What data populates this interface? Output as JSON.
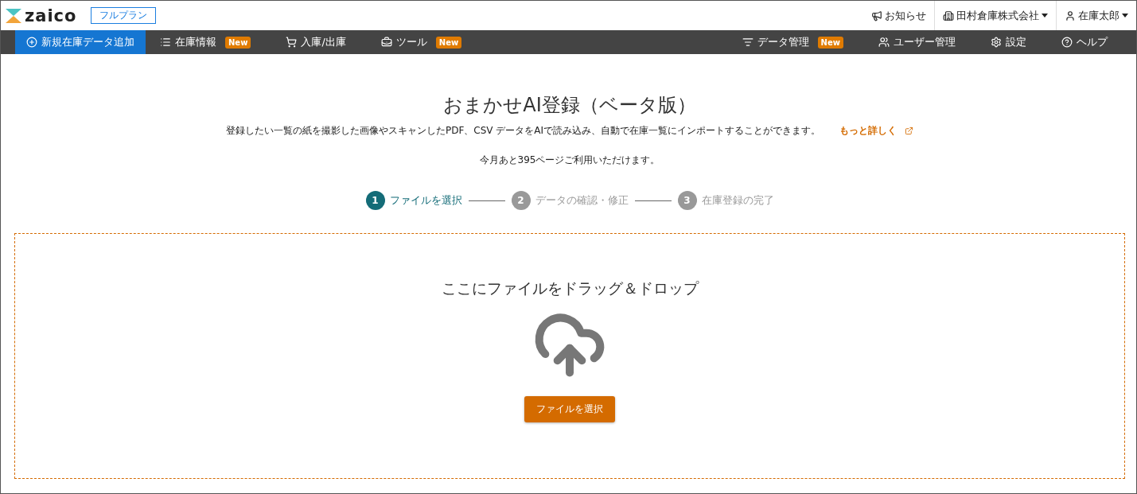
{
  "header": {
    "logo": "zaico",
    "plan": "フルプラン",
    "links": [
      {
        "label": "お知らせ",
        "dropdown": false
      },
      {
        "label": "田村倉庫株式会社",
        "dropdown": true
      },
      {
        "label": "在庫太郎",
        "dropdown": true
      }
    ]
  },
  "nav": {
    "left": [
      {
        "label": "新規在庫データ追加",
        "selected": true
      },
      {
        "label": "在庫情報",
        "badge": "New",
        "selected": false
      },
      {
        "label": "入庫/出庫",
        "selected": false
      },
      {
        "label": "ツール",
        "badge": "New",
        "selected": false
      }
    ],
    "right": [
      {
        "label": "データ管理",
        "badge": "New",
        "selected": false
      },
      {
        "label": "ユーザー管理",
        "selected": false
      },
      {
        "label": "設定",
        "selected": false
      },
      {
        "label": "ヘルプ",
        "selected": false
      }
    ]
  },
  "title": "おまかせAI登録（ベータ版）",
  "description": "登録したい一覧の紙を撮影した画像やスキャンしたPDF、CSV データをAIで読み込み、自動で在庫一覧にインポートすることができます。",
  "more_link": "もっと詳しく",
  "remaining": "今月あと395ページご利用いただけます。",
  "steps": [
    {
      "number": "1",
      "label": "ファイルを選択",
      "selected": true
    },
    {
      "number": "2",
      "label": "データの確認・修正",
      "selected": false
    },
    {
      "number": "3",
      "label": "在庫登録の完了",
      "selected": false
    }
  ],
  "dropzone": {
    "prompt": "ここにファイルをドラッグ＆ドロップ",
    "button": "ファイルを選択"
  }
}
